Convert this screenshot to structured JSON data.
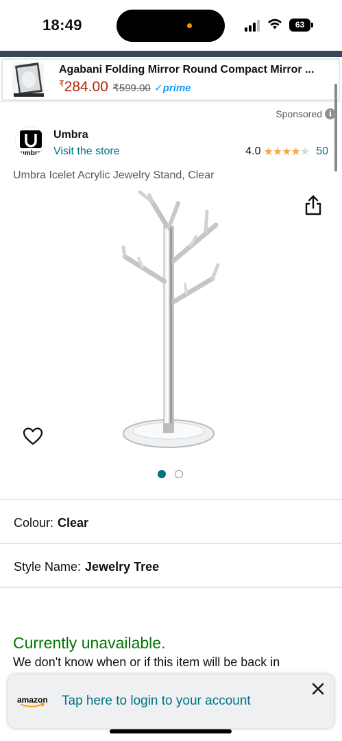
{
  "status_bar": {
    "time": "18:49",
    "battery": "63",
    "icons": [
      "signal-icon",
      "wifi-icon",
      "battery-icon"
    ]
  },
  "ad": {
    "title": "Agabani Folding Mirror Round Compact Mirror ...",
    "currency": "₹",
    "price": "284.00",
    "mrp": "₹599.00",
    "prime_label": "prime",
    "price_color": "#b12704"
  },
  "sponsored": {
    "label": "Sponsored",
    "info_glyph": "i"
  },
  "brand": {
    "name": "Umbra",
    "visit_store": "Visit the store",
    "logo_text": "umbra",
    "rating": "4.0",
    "rating_value": 4.0,
    "rating_max": 5,
    "rating_count": "50"
  },
  "product": {
    "title": "Umbra Icelet Acrylic Jewelry Stand, Clear",
    "image_count": 2,
    "active_image": 1
  },
  "variants": [
    {
      "label": "Colour:",
      "value": "Clear"
    },
    {
      "label": "Style Name:",
      "value": "Jewelry Tree"
    }
  ],
  "availability": {
    "status": "Currently unavailable.",
    "note": "We don't know when or if this item will be back in",
    "status_color": "#007600"
  },
  "login_toast": {
    "logo": "amazon",
    "text": "Tap here to login to your account"
  },
  "colors": {
    "link": "#007185",
    "star": "#f3a847",
    "header_band": "#37475a"
  }
}
